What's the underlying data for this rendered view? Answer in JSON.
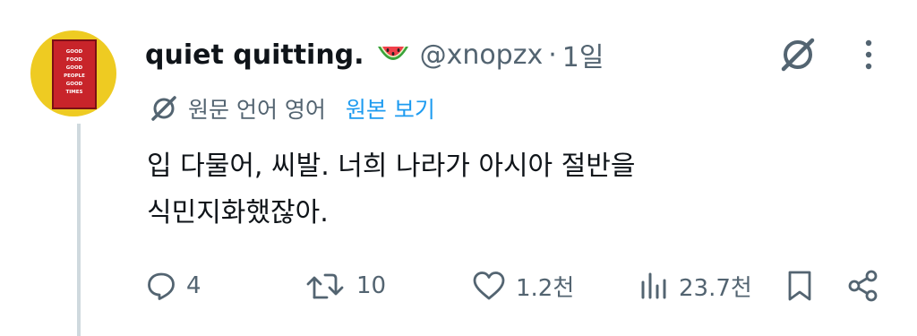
{
  "tweet": {
    "display_name": "quiet quitting.",
    "handle": "@xnopzx",
    "separator": "·",
    "time": "1일",
    "translate_label": "원문 언어 영어",
    "translate_link": "원본 보기",
    "text_line1": "입 다물어, 씨발. 너희 나라가 아시아 절반을",
    "text_line2": "식민지화했잖아."
  },
  "avatar": {
    "sign_line1": "GOOD FOOD",
    "sign_line2": "GOOD PEOPLE",
    "sign_line3": "GOOD TIMES"
  },
  "actions": {
    "replies": "4",
    "retweets": "10",
    "likes": "1.2천",
    "views": "23.7천"
  },
  "colors": {
    "text": "#0f1419",
    "secondary": "#536471",
    "link": "#1d9bf0",
    "avatar_bg": "#eecb22",
    "sign_red": "#c8242a"
  },
  "icons": [
    "watermelon-icon",
    "grok-icon",
    "more-icon",
    "translate-icon",
    "reply-icon",
    "retweet-icon",
    "like-icon",
    "views-icon",
    "bookmark-icon",
    "share-icon"
  ]
}
